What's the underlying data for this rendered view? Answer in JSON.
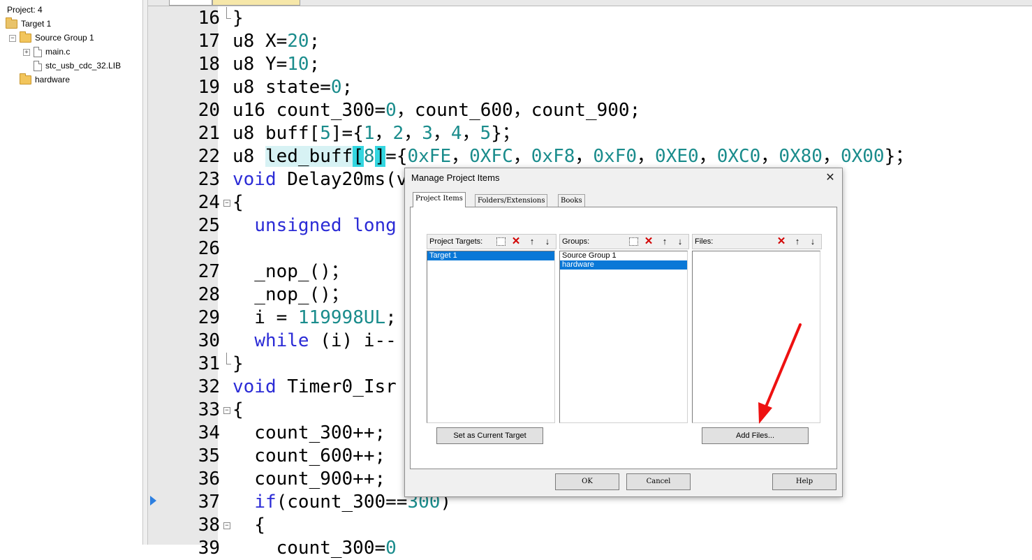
{
  "project_tree": {
    "title": "Project: 4",
    "items": [
      {
        "label": "Target 1"
      },
      {
        "label": "Source Group 1"
      },
      {
        "label": "main.c"
      },
      {
        "label": "stc_usb_cdc_32.LIB"
      },
      {
        "label": "hardware"
      }
    ]
  },
  "editor": {
    "lines": [
      {
        "num": "16",
        "tokens": [
          {
            "t": "}",
            "c": ""
          }
        ]
      },
      {
        "num": "17",
        "tokens": [
          {
            "t": "u8 X=",
            "c": ""
          },
          {
            "t": "20",
            "c": "num"
          },
          {
            "t": ";",
            "c": ""
          }
        ]
      },
      {
        "num": "18",
        "tokens": [
          {
            "t": "u8 Y=",
            "c": ""
          },
          {
            "t": "10",
            "c": "num"
          },
          {
            "t": ";",
            "c": ""
          }
        ]
      },
      {
        "num": "19",
        "tokens": [
          {
            "t": "u8 state=",
            "c": ""
          },
          {
            "t": "0",
            "c": "num"
          },
          {
            "t": ";",
            "c": ""
          }
        ]
      },
      {
        "num": "20",
        "tokens": [
          {
            "t": "u16 count_300=",
            "c": ""
          },
          {
            "t": "0",
            "c": "num"
          },
          {
            "t": "，count_600，count_900;",
            "c": ""
          }
        ]
      },
      {
        "num": "21",
        "tokens": [
          {
            "t": "u8 buff[",
            "c": ""
          },
          {
            "t": "5",
            "c": "num"
          },
          {
            "t": "]={",
            "c": ""
          },
          {
            "t": "1",
            "c": "num"
          },
          {
            "t": "，",
            "c": ""
          },
          {
            "t": "2",
            "c": "num"
          },
          {
            "t": "，",
            "c": ""
          },
          {
            "t": "3",
            "c": "num"
          },
          {
            "t": "，",
            "c": ""
          },
          {
            "t": "4",
            "c": "num"
          },
          {
            "t": "，",
            "c": ""
          },
          {
            "t": "5",
            "c": "num"
          },
          {
            "t": "}；",
            "c": ""
          }
        ]
      },
      {
        "num": "22",
        "tokens": [
          {
            "t": "u8 ",
            "c": ""
          },
          {
            "t": "led_buff",
            "c": "hl-word"
          },
          {
            "t": "[",
            "c": "hl"
          },
          {
            "t": "8",
            "c": "num"
          },
          {
            "t": "]",
            "c": "hl"
          },
          {
            "t": "={",
            "c": ""
          },
          {
            "t": "0xFE",
            "c": "num"
          },
          {
            "t": "，",
            "c": ""
          },
          {
            "t": "0XFC",
            "c": "num"
          },
          {
            "t": "，",
            "c": ""
          },
          {
            "t": "0xF8",
            "c": "num"
          },
          {
            "t": "，",
            "c": ""
          },
          {
            "t": "0xF0",
            "c": "num"
          },
          {
            "t": "，",
            "c": ""
          },
          {
            "t": "0XE0",
            "c": "num"
          },
          {
            "t": "，",
            "c": ""
          },
          {
            "t": "0XC0",
            "c": "num"
          },
          {
            "t": "，",
            "c": ""
          },
          {
            "t": "0X80",
            "c": "num"
          },
          {
            "t": "，",
            "c": ""
          },
          {
            "t": "0X00",
            "c": "num"
          },
          {
            "t": "}；",
            "c": ""
          }
        ]
      },
      {
        "num": "23",
        "tokens": [
          {
            "t": "void",
            "c": "kw"
          },
          {
            "t": " Delay20ms(v",
            "c": ""
          }
        ]
      },
      {
        "num": "24",
        "tokens": [
          {
            "t": "{",
            "c": ""
          }
        ]
      },
      {
        "num": "25",
        "tokens": [
          {
            "t": "  ",
            "c": ""
          },
          {
            "t": "unsigned long",
            "c": "kw"
          }
        ]
      },
      {
        "num": "26",
        "tokens": []
      },
      {
        "num": "27",
        "tokens": [
          {
            "t": "  _nop_()；",
            "c": ""
          }
        ]
      },
      {
        "num": "28",
        "tokens": [
          {
            "t": "  _nop_()；",
            "c": ""
          }
        ]
      },
      {
        "num": "29",
        "tokens": [
          {
            "t": "  i = ",
            "c": ""
          },
          {
            "t": "119998UL",
            "c": "num"
          },
          {
            "t": ";",
            "c": ""
          }
        ]
      },
      {
        "num": "30",
        "tokens": [
          {
            "t": "  ",
            "c": ""
          },
          {
            "t": "while",
            "c": "kw"
          },
          {
            "t": " (i) i--",
            "c": ""
          }
        ]
      },
      {
        "num": "31",
        "tokens": [
          {
            "t": "}",
            "c": ""
          }
        ]
      },
      {
        "num": "32",
        "tokens": [
          {
            "t": "void",
            "c": "kw"
          },
          {
            "t": " Timer0_Isr",
            "c": ""
          }
        ]
      },
      {
        "num": "33",
        "tokens": [
          {
            "t": "{",
            "c": ""
          }
        ]
      },
      {
        "num": "34",
        "tokens": [
          {
            "t": "  count_300++;",
            "c": ""
          }
        ]
      },
      {
        "num": "35",
        "tokens": [
          {
            "t": "  count_600++;",
            "c": ""
          }
        ]
      },
      {
        "num": "36",
        "tokens": [
          {
            "t": "  count_900++;",
            "c": ""
          }
        ]
      },
      {
        "num": "37",
        "tokens": [
          {
            "t": "  ",
            "c": ""
          },
          {
            "t": "if",
            "c": "kw"
          },
          {
            "t": "(count_300==",
            "c": ""
          },
          {
            "t": "300",
            "c": "num"
          },
          {
            "t": ")",
            "c": ""
          }
        ]
      },
      {
        "num": "38",
        "tokens": [
          {
            "t": "  {",
            "c": ""
          }
        ]
      },
      {
        "num": "39",
        "tokens": [
          {
            "t": "    count_300=",
            "c": ""
          },
          {
            "t": "0",
            "c": "num"
          }
        ]
      }
    ]
  },
  "dialog": {
    "title": "Manage Project Items",
    "close_glyph": "✕",
    "tabs": [
      "Project Items",
      "Folders/Extensions",
      "Books"
    ],
    "targets": {
      "header": "Project Targets:",
      "items": [
        "Target 1"
      ],
      "selected": 0
    },
    "groups": {
      "header": "Groups:",
      "items": [
        "Source Group 1",
        "hardware"
      ],
      "selected": 1
    },
    "files": {
      "header": "Files:",
      "items": []
    },
    "buttons": {
      "set_target": "Set as Current Target",
      "add_files": "Add Files...",
      "ok": "OK",
      "cancel": "Cancel",
      "help": "Help"
    },
    "toolbar_glyphs": {
      "delete": "✕",
      "up": "🡅",
      "down": "🡇"
    }
  },
  "annotation": {
    "color": "#ee1111"
  },
  "colors": {
    "keyword": "#2b2bd6",
    "number": "#1a8c8c",
    "selection": "#0a78d7"
  }
}
